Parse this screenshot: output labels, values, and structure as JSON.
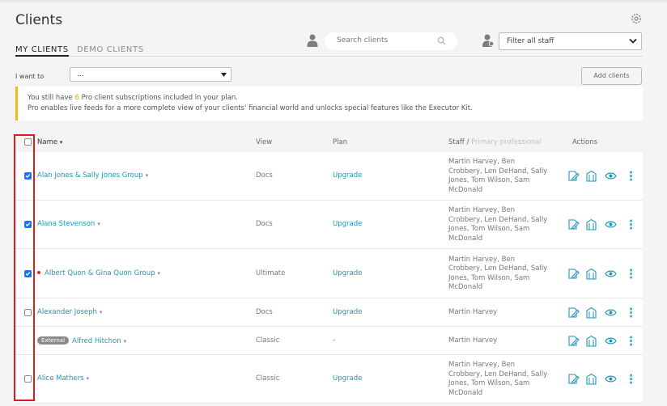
{
  "page": {
    "title": "Clients"
  },
  "tabs": [
    {
      "label": "MY CLIENTS",
      "active": true
    },
    {
      "label": "DEMO CLIENTS",
      "active": false
    }
  ],
  "search": {
    "placeholder": "Search clients"
  },
  "staff_filter": {
    "value": "Filter all staff"
  },
  "bulk": {
    "label": "I want to",
    "value": "..."
  },
  "add_clients_label": "Add clients",
  "notice": {
    "line1_before": "You still have ",
    "count": "6",
    "line1_after": " Pro client subscriptions included in your plan.",
    "line2": "Pro enables live feeds for a more complete view of your clients' financial world and unlocks special features like the Executor Kit."
  },
  "table": {
    "headers": {
      "name": "Name",
      "view": "View",
      "plan": "Plan",
      "staff": "Staff /",
      "primary": "Primary professional",
      "actions": "Actions"
    },
    "rows": [
      {
        "name": "Alan Jones & Sally Jones Group",
        "view": "Docs",
        "plan": "Upgrade",
        "checked": true,
        "alert": false,
        "external": false,
        "staff_lines": [
          "Martin Harvey, Ben",
          "Crobbery, Len DeHand, Sally",
          "Jones, Tom Wilson, Sam",
          "McDonald"
        ]
      },
      {
        "name": "Alana Stevenson",
        "view": "Docs",
        "plan": "Upgrade",
        "checked": true,
        "alert": false,
        "external": false,
        "staff_lines": [
          "Martin Harvey, Ben",
          "Crobbery, Len DeHand, Sally",
          "Jones, Tom Wilson, Sam",
          "McDonald"
        ]
      },
      {
        "name": "Albert Quon & Gina Quon Group",
        "view": "Ultimate",
        "plan": "Upgrade",
        "checked": true,
        "alert": true,
        "external": false,
        "staff_lines": [
          "Martin Harvey, Ben",
          "Crobbery, Len DeHand, Sally",
          "Jones, Tom Wilson, Sam",
          "McDonald"
        ]
      },
      {
        "name": "Alexander Joseph",
        "view": "Docs",
        "plan": "Upgrade",
        "checked": false,
        "alert": false,
        "external": false,
        "staff_lines": [
          "Martin Harvey"
        ]
      },
      {
        "name": "Alfred Hitchon",
        "view": "Classic",
        "plan": "-",
        "checked": null,
        "alert": false,
        "external": true,
        "badge": "External",
        "staff_lines": [
          "Martin Harvey"
        ]
      },
      {
        "name": "Alice Mathers",
        "view": "Classic",
        "plan": "Upgrade",
        "checked": false,
        "alert": false,
        "external": false,
        "staff_lines": [
          "Martin Harvey, Ben",
          "Crobbery, Len DeHand, Sally",
          "Jones, Tom Wilson, Sam",
          "McDonald"
        ]
      }
    ]
  },
  "icons": {
    "settings": "gear-icon",
    "search": "search-icon",
    "user": "person-icon",
    "row_actions": [
      "edit-document-icon",
      "vault-icon",
      "view-icon",
      "more-icon"
    ]
  },
  "colors": {
    "link": "#2196b6",
    "accent_warning": "#f5b916",
    "checkbox": "#1a73e8",
    "highlight_box": "#e11b1b",
    "alert_dot": "#e0262b"
  }
}
